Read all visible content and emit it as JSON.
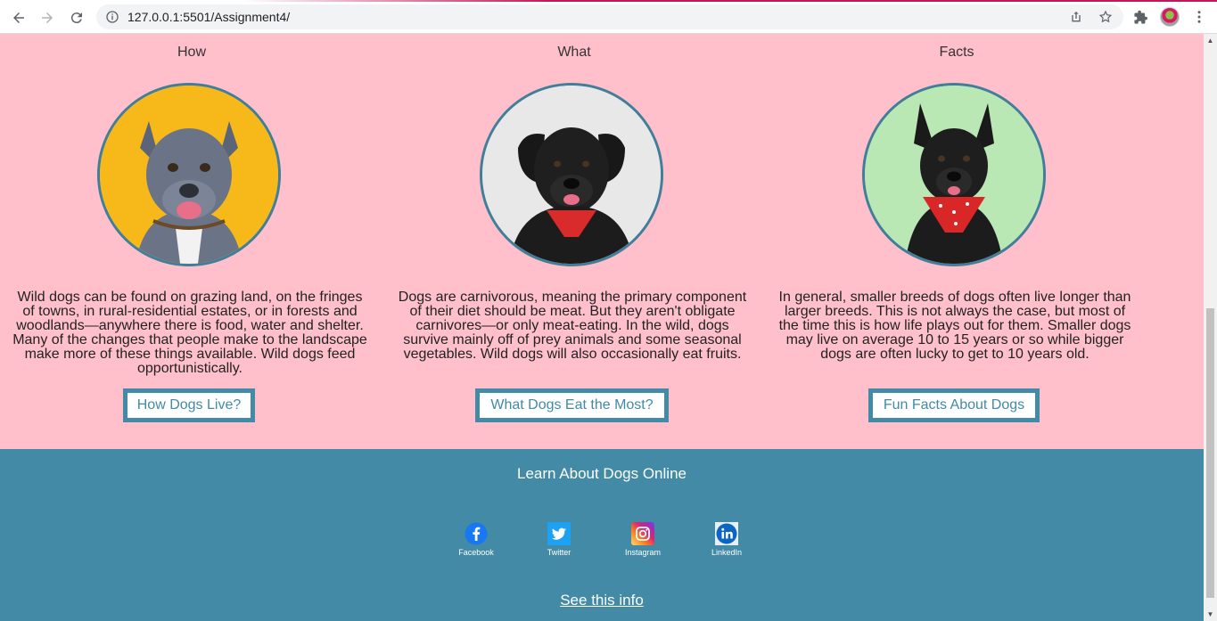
{
  "browser": {
    "url": "127.0.0.1:5501/Assignment4/"
  },
  "columns": [
    {
      "heading": "How",
      "text": "Wild dogs can be found on grazing land, on the fringes of towns, in rural-residential estates, or in forests and woodlands—anywhere there is food, water and shelter. Many of the changes that people make to the landscape make more of these things available. Wild dogs feed opportunistically.",
      "button": "How Dogs Live?",
      "image_bg": "#f7b81a"
    },
    {
      "heading": "What",
      "text": "Dogs are carnivorous, meaning the primary component of their diet should be meat. But they aren't obligate carnivores—or only meat-eating. In the wild, dogs survive mainly off of prey animals and some seasonal vegetables. Wild dogs will also occasionally eat fruits.",
      "button": "What Dogs Eat the Most?",
      "image_bg": "#e8e8e8"
    },
    {
      "heading": "Facts",
      "text": "In general, smaller breeds of dogs often live longer than larger breeds. This is not always the case, but most of the time this is how life plays out for them. Smaller dogs may live on average 10 to 15 years or so while bigger dogs are often lucky to get to 10 years old.",
      "button": "Fun Facts About Dogs",
      "image_bg": "#b9e8b4"
    }
  ],
  "footer": {
    "title": "Learn About Dogs Online",
    "social": [
      {
        "label": "Facebook",
        "icon": "facebook-icon"
      },
      {
        "label": "Twitter",
        "icon": "twitter-icon"
      },
      {
        "label": "Instagram",
        "icon": "instagram-icon"
      },
      {
        "label": "LinkedIn",
        "icon": "linkedin-icon"
      }
    ],
    "link": "See this info"
  },
  "colors": {
    "page_bg": "#ffc0cb",
    "accent": "#428aa6"
  }
}
